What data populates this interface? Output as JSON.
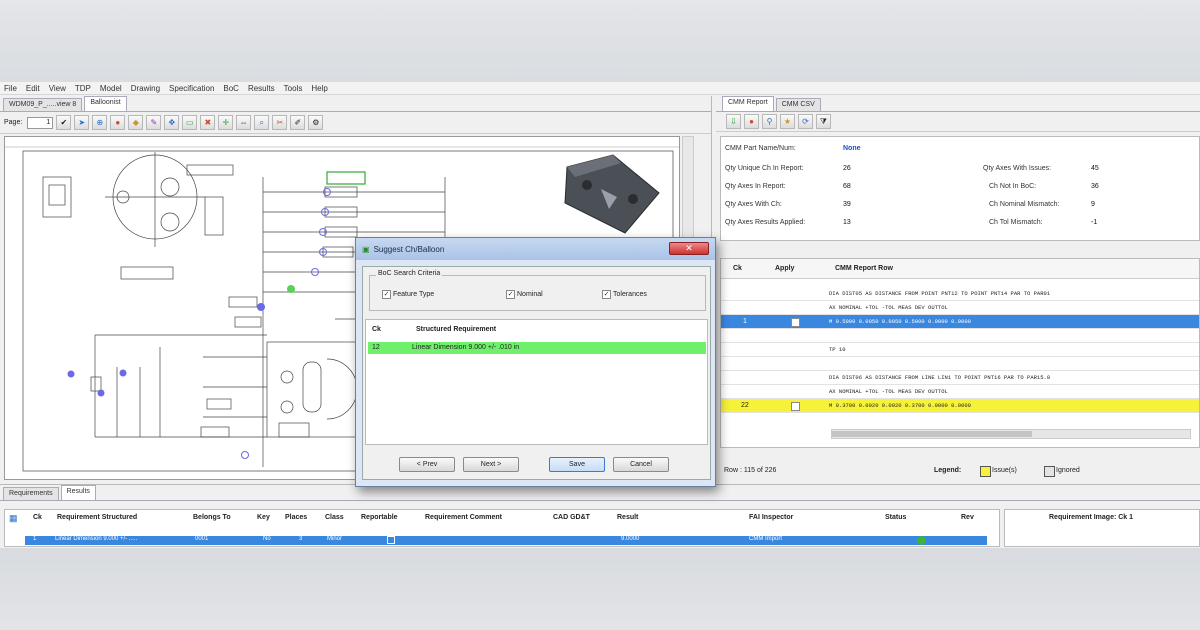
{
  "menu": [
    "File",
    "Edit",
    "View",
    "TDP",
    "Model",
    "Drawing",
    "Specification",
    "BoC",
    "Results",
    "Tools",
    "Help"
  ],
  "left_tabs": [
    "WDM09_P_.....view 8",
    "Balloonist"
  ],
  "toolbar": {
    "page_label": "Page:",
    "page_value": "1"
  },
  "right_tabs": [
    "CMM Report",
    "CMM CSV"
  ],
  "cmm_info": {
    "part_name_label": "CMM Part Name/Num:",
    "part_name_value": "None",
    "unique_label": "Qty Unique Ch In Report:",
    "unique_value": "26",
    "axes_report_label": "Qty Axes In Report:",
    "axes_report_value": "68",
    "axes_ch_label": "Qty Axes With Ch:",
    "axes_ch_value": "39",
    "applied_label": "Qty Axes Results Applied:",
    "applied_value": "13",
    "issues_label": "Qty Axes With Issues:",
    "issues_value": "45",
    "not_in_boc_label": "Ch Not In BoC:",
    "not_in_boc_value": "36",
    "nominal_mismatch_label": "Ch Nominal Mismatch:",
    "nominal_mismatch_value": "9",
    "tol_mismatch_label": "Ch Tol Mismatch:",
    "tol_mismatch_value": "-1"
  },
  "cmm_grid": {
    "headers": {
      "ck": "Ck",
      "apply": "Apply",
      "row": "CMM Report Row"
    },
    "rows": [
      {
        "text": "DIA DIST05 AS DISTANCE FROM POINT PNT12 TO POINT PNT14 PAR TO  PAR01"
      },
      {
        "text": "AX    NOMINAL      +TOL       -TOL       MEAS       DEV     OUTTOL"
      },
      {
        "ck": "1",
        "text": "M    0.5000     0.0050     0.0050     0.5000     0.0000   0.0000",
        "style": "blue"
      },
      {
        "text": ""
      },
      {
        "text": "TP 10"
      },
      {
        "text": ""
      },
      {
        "text": "DIA DIST06 AS DISTANCE FROM LINE LIN1 TO POINT PNT16 PAR TO  PAR15.8"
      },
      {
        "text": "AX    NOMINAL      +TOL       -TOL       MEAS       DEV     OUTTOL"
      },
      {
        "ck": "22",
        "text": "M    0.3700     0.0020     0.0020     0.3700     0.0000   0.0000",
        "style": "yellow"
      }
    ]
  },
  "status": {
    "row_count": "Row : 115 of 226",
    "legend_label": "Legend:",
    "legend_issue": "Issue(s)",
    "legend_ignored": "Ignored"
  },
  "bottom_tabs": [
    "Requirements",
    "Results"
  ],
  "results_table": {
    "headers": [
      "Ck",
      "Requirement Structured",
      "Belongs To",
      "Key",
      "Places",
      "Class",
      "Reportable",
      "Requirement Comment",
      "CAD GD&T",
      "Result",
      "FAI Inspector",
      "Status",
      "Rev"
    ],
    "row": {
      "ck": "1",
      "requirement": "Linear Dimension 9.000 +/- .....",
      "belongs_to": "0001",
      "key": "No",
      "places": "3",
      "class": "Minor",
      "result": "9.0000",
      "inspector": "CMM Import"
    },
    "image_header": "Requirement Image: Ck 1"
  },
  "dialog": {
    "title": "Suggest Ch/Balloon",
    "close": "✕",
    "criteria_label": "BoC Search Criteria",
    "feature_type": "Feature Type",
    "nominal": "Nominal",
    "tolerances": "Tolerances",
    "table_headers": {
      "ck": "Ck",
      "req": "Structured Requirement"
    },
    "match": {
      "ck": "12",
      "text": "Linear Dimension 9.000 +/- .010 in"
    },
    "buttons": {
      "prev": "< Prev",
      "next": "Next >",
      "save": "Save",
      "cancel": "Cancel"
    }
  }
}
